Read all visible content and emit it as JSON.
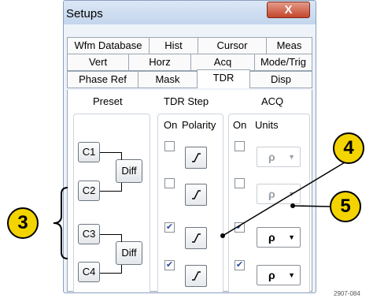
{
  "window": {
    "title": "Setups",
    "close_glyph": "X"
  },
  "tabs": {
    "row1": [
      "Wfm Database",
      "Hist",
      "Cursor",
      "Meas"
    ],
    "row2": [
      "Vert",
      "Horz",
      "Acq",
      "Mode/Trig"
    ],
    "row3": [
      "Phase Ref",
      "Mask",
      "TDR",
      "Disp"
    ],
    "active": "TDR"
  },
  "tdr": {
    "preset": {
      "header": "Preset",
      "buttons": [
        "C1",
        "C2",
        "C3",
        "C4"
      ],
      "diff_label": "Diff"
    },
    "tdr_step": {
      "header": "TDR Step",
      "col_on": "On",
      "col_polarity": "Polarity",
      "rows": [
        {
          "on": false
        },
        {
          "on": false
        },
        {
          "on": true
        },
        {
          "on": true
        }
      ]
    },
    "acq": {
      "header": "ACQ",
      "col_on": "On",
      "col_units": "Units",
      "rows": [
        {
          "on": false,
          "units": "ρ",
          "enabled": false
        },
        {
          "on": false,
          "units": "ρ",
          "enabled": false
        },
        {
          "on": true,
          "units": "ρ",
          "enabled": true
        },
        {
          "on": true,
          "units": "ρ",
          "enabled": true
        }
      ]
    }
  },
  "callouts": [
    "3",
    "4",
    "5"
  ],
  "figure_id": "2907-084",
  "icons": {
    "polarity": "rising-step-icon",
    "dropdown": "down-arrow-icon",
    "checkbox_checked": "check-icon"
  },
  "colors": {
    "callout_fill": "#f3d400",
    "close_button": "#c4462c",
    "window_bg": "#eef3fa"
  }
}
